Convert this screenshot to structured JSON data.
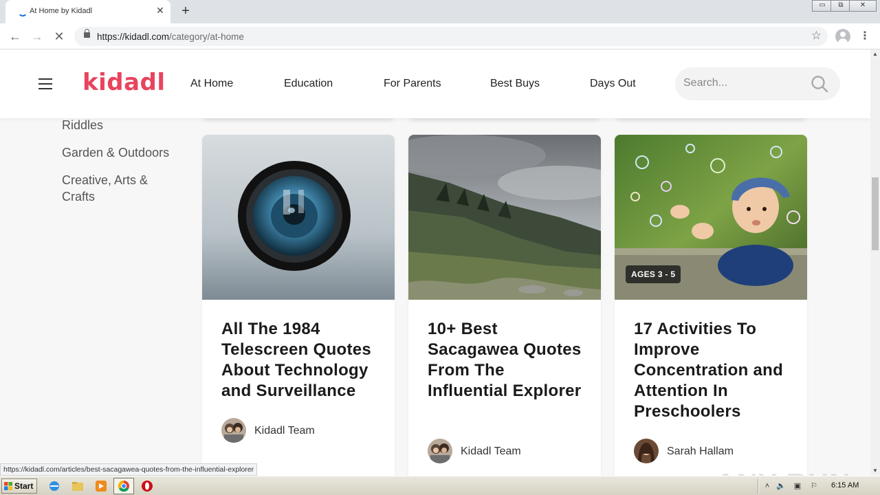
{
  "browser": {
    "tab_title": "At Home by Kidadl",
    "tab_close": "✕",
    "new_tab": "+",
    "url_host": "https://kidadl.com",
    "url_path": "/category/at-home",
    "back": "←",
    "forward": "→",
    "reload": "✕",
    "bookmark": "☆",
    "menu": "⋮",
    "window_controls": [
      "▭",
      "⧉",
      "✕"
    ]
  },
  "site": {
    "logo": "kidadl",
    "nav": [
      "At Home",
      "Education",
      "For Parents",
      "Best Buys",
      "Days Out"
    ],
    "search_placeholder": "Search...",
    "accent_color": "#e8445e"
  },
  "sidebar": {
    "items": [
      "Riddles",
      "Garden & Outdoors",
      "Creative, Arts & Crafts"
    ]
  },
  "cards": [
    {
      "title": "All The 1984 Telescreen Quotes About Technology and Surveillance",
      "author": "Kidadl Team",
      "image": "camera-lens-image",
      "badge": ""
    },
    {
      "title": "10+ Best Sacagawea Quotes From The Influential Explorer",
      "author": "Kidadl Team",
      "image": "mountain-landscape-image",
      "badge": ""
    },
    {
      "title": "17 Activities To Improve Concentration and Attention In Preschoolers",
      "author": "Sarah Hallam",
      "image": "child-bubbles-image",
      "badge": "AGES 3 - 5"
    }
  ],
  "watermark": "ANY RUN",
  "status_url": "https://kidadl.com/articles/best-sacagawea-quotes-from-the-influential-explorer",
  "taskbar": {
    "start": "Start",
    "clock": "6:15 AM"
  }
}
